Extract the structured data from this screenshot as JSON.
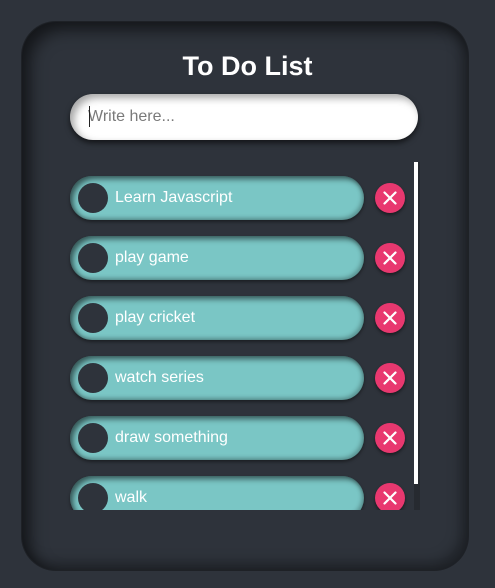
{
  "app": {
    "title": "To Do List"
  },
  "input": {
    "placeholder": "Write here...",
    "value": ""
  },
  "todos": [
    {
      "label": "Learn Javascript"
    },
    {
      "label": "play game"
    },
    {
      "label": "play cricket"
    },
    {
      "label": "watch series"
    },
    {
      "label": "draw something"
    },
    {
      "label": "walk"
    }
  ],
  "colors": {
    "background": "#2e333b",
    "item": "#7ac6c5",
    "delete": "#e8386f",
    "text": "#ffffff"
  },
  "icons": {
    "checkbox": "circle-check-icon",
    "delete": "close-icon"
  }
}
